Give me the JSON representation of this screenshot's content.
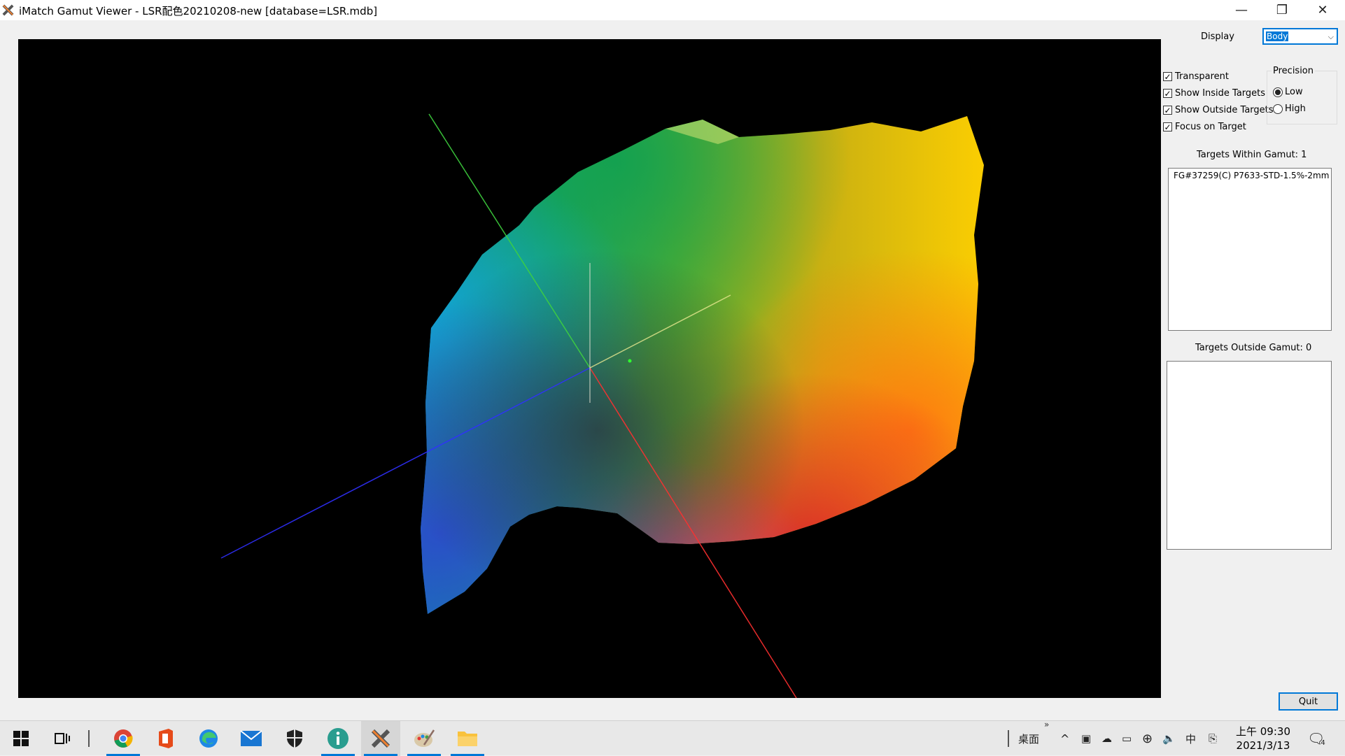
{
  "window": {
    "title": "iMatch Gamut Viewer - LSR配色20210208-new [database=LSR.mdb]",
    "minimize_glyph": "—",
    "restore_glyph": "❐",
    "close_glyph": "✕"
  },
  "controls": {
    "display_label": "Display",
    "display_value": "Body",
    "checkboxes": [
      {
        "label": "Transparent",
        "checked": true
      },
      {
        "label": "Show Inside Targets",
        "checked": true
      },
      {
        "label": "Show Outside Targets",
        "checked": true
      },
      {
        "label": "Focus on Target",
        "checked": true
      }
    ],
    "check_glyph": "✓",
    "precision": {
      "title": "Precision",
      "options": [
        {
          "label": "Low",
          "selected": true
        },
        {
          "label": "High",
          "selected": false
        }
      ]
    },
    "inside_title": "Targets Within Gamut: 1",
    "inside_items": [
      "FG#37259(C) P7633-STD-1.5%-2mm"
    ],
    "outside_title": "Targets Outside Gamut: 0",
    "outside_items": [],
    "quit_label": "Quit"
  },
  "taskbar": {
    "apps": [
      "start-icon",
      "task-view-icon",
      "chrome-icon",
      "office-icon",
      "edge-icon",
      "mail-icon",
      "security-icon",
      "info-app-icon",
      "imatch-icon",
      "paint-icon",
      "explorer-icon"
    ],
    "desktop_label": "桌面",
    "ime_label": "中",
    "time": "上午 09:30",
    "date": "2021/3/13",
    "notification_count": "4"
  },
  "colors": {
    "accent": "#0078d7",
    "viewport_bg": "#000000"
  }
}
